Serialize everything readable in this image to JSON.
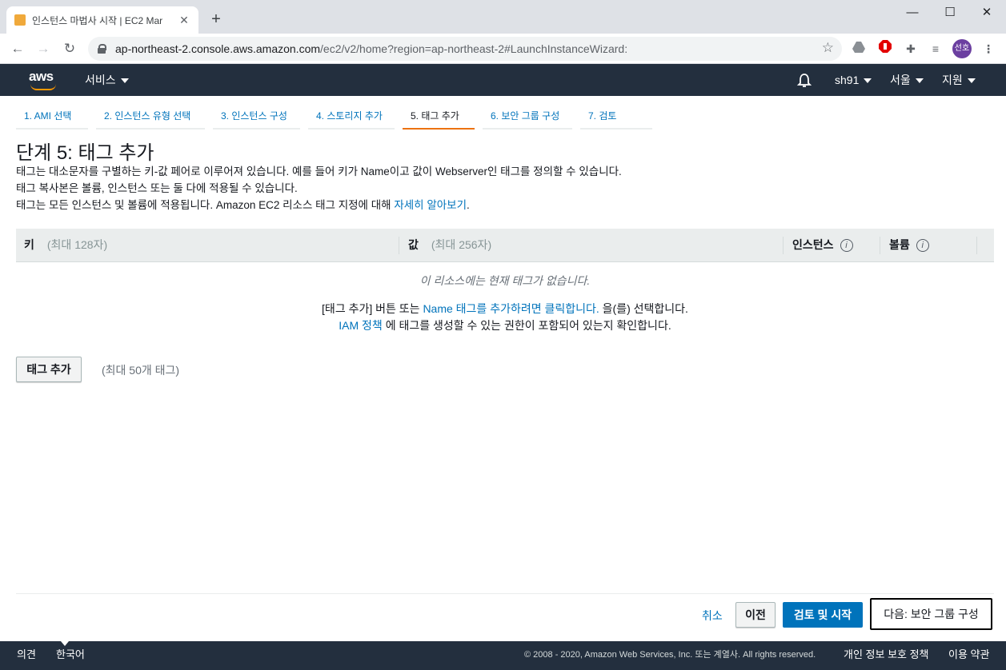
{
  "browser": {
    "tab_title": "인스턴스 마법사 시작 | EC2 Mar",
    "tab_close": "✕",
    "new_tab": "+",
    "url_host": "ap-northeast-2.console.aws.amazon.com",
    "url_path": "/ec2/v2/home?region=ap-northeast-2#LaunchInstanceWizard:",
    "profile_initials": "선호",
    "window_controls": {
      "minimize": "—",
      "maximize": "☐",
      "close": "✕"
    }
  },
  "aws_header": {
    "logo_text": "aws",
    "services": "서비스",
    "user": "sh91",
    "region": "서울",
    "support": "지원"
  },
  "steps": [
    {
      "label": "1. AMI 선택"
    },
    {
      "label": "2. 인스턴스 유형 선택"
    },
    {
      "label": "3. 인스턴스 구성"
    },
    {
      "label": "4. 스토리지 추가"
    },
    {
      "label": "5. 태그 추가"
    },
    {
      "label": "6. 보안 그룹 구성"
    },
    {
      "label": "7. 검토"
    }
  ],
  "page": {
    "title": "단계 5: 태그 추가",
    "desc1": "태그는 대소문자를 구별하는 키-값 페어로 이루어져 있습니다. 예를 들어 키가 Name이고 값이 Webserver인 태그를 정의할 수 있습니다.",
    "desc2": "태그 복사본은 볼륨, 인스턴스 또는 둘 다에 적용될 수 있습니다.",
    "desc3_prefix": "태그는 모든 인스턴스 및 볼륨에 적용됩니다. Amazon EC2 리소스 태그 지정에 대해 ",
    "desc3_link": "자세히 알아보기",
    "desc3_suffix": "."
  },
  "table": {
    "col_key": "키",
    "col_key_hint": "(최대 128자)",
    "col_value": "값",
    "col_value_hint": "(최대 256자)",
    "col_instances": "인스턴스",
    "col_volumes": "볼륨",
    "info_glyph": "i",
    "empty_message": "이 리소스에는 현재 태그가 없습니다.",
    "hint1_prefix": "[태그 추가] 버튼 또는 ",
    "hint1_link": "Name 태그를 추가하려면 클릭합니다.",
    "hint1_suffix": " 을(를) 선택합니다.",
    "hint2_link": "IAM 정책",
    "hint2_suffix": " 에 태그를 생성할 수 있는 권한이 포함되어 있는지 확인합니다."
  },
  "actions": {
    "add_tag": "태그 추가",
    "max_tags": "(최대 50개 태그)",
    "cancel": "취소",
    "previous": "이전",
    "review_launch": "검토 및 시작",
    "next": "다음: 보안 그룹 구성"
  },
  "footer": {
    "feedback": "의견",
    "language": "한국어",
    "copyright": "© 2008 - 2020, Amazon Web Services, Inc. 또는 계열사. All rights reserved.",
    "privacy": "개인 정보 보호 정책",
    "terms": "이용 약관"
  },
  "colors": {
    "aws_dark": "#232f3e",
    "aws_orange": "#ff9900",
    "link_blue": "#0073bb",
    "step_active": "#ec7211"
  }
}
